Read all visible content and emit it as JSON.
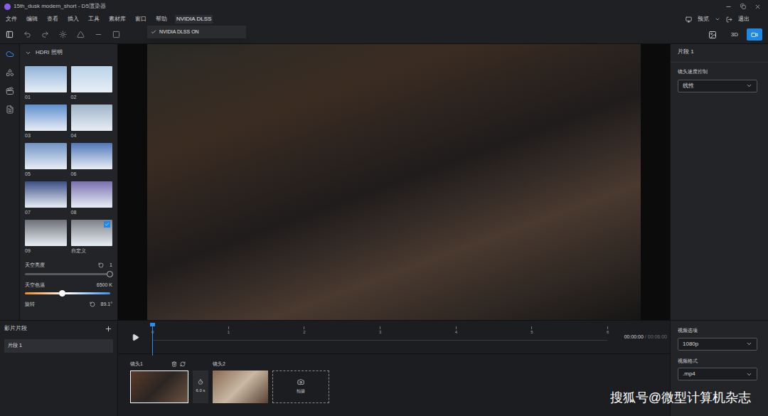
{
  "window": {
    "title": "15th_dusk modern_short - D5渲染器"
  },
  "menu": [
    {
      "label": "文件",
      "open": false
    },
    {
      "label": "编辑",
      "open": false
    },
    {
      "label": "查看",
      "open": false
    },
    {
      "label": "插入",
      "open": false
    },
    {
      "label": "工具",
      "open": false
    },
    {
      "label": "素材库",
      "open": false
    },
    {
      "label": "窗口",
      "open": false
    },
    {
      "label": "帮助",
      "open": false
    },
    {
      "label": "NVIDIA DLSS",
      "open": true
    }
  ],
  "dropdown": {
    "items": [
      {
        "label": "NVIDIA DLSS ON",
        "checked": true
      }
    ]
  },
  "header_right": {
    "preview": "预览",
    "exit": "退出"
  },
  "mode_3d": {
    "label": "3D",
    "selected": false
  },
  "mode_camera": {
    "selected": true
  },
  "left_nav": [
    {
      "selected": true
    },
    {
      "selected": false
    },
    {
      "selected": false
    },
    {
      "selected": false
    }
  ],
  "hdri": {
    "title": "HDRI 照明",
    "expanded": true,
    "presets": [
      {
        "label": "01",
        "selected": false,
        "color": "#8fb3d9"
      },
      {
        "label": "02",
        "selected": false,
        "color": "#b9d3ea"
      },
      {
        "label": "03",
        "selected": false,
        "color": "#5d8fcf"
      },
      {
        "label": "04",
        "selected": false,
        "color": "#9fb5c9"
      },
      {
        "label": "05",
        "selected": false,
        "color": "#6f94c4"
      },
      {
        "label": "06",
        "selected": false,
        "color": "#4f78b8"
      },
      {
        "label": "07",
        "selected": false,
        "color": "#3b4f86"
      },
      {
        "label": "08",
        "selected": false,
        "color": "#7a6fb0"
      },
      {
        "label": "09",
        "selected": false,
        "color": "#6c6f76"
      },
      {
        "label": "自定义",
        "selected": true,
        "color": "#7d8087"
      }
    ]
  },
  "sliders": [
    {
      "label": "天空亮度",
      "reading": "1",
      "level": 1.0,
      "kind": "plain",
      "reset": true
    },
    {
      "label": "天空色温",
      "reading": "6500 K",
      "level": 0.44,
      "kind": "gradient",
      "reset": false
    },
    {
      "label": "旋转",
      "reading": "89.1°",
      "kind": "cut",
      "reset": true
    }
  ],
  "right_panel": {
    "title": "片段 1",
    "speed_label": "镜头速度控制",
    "speed_value": "线性"
  },
  "clips_panel": {
    "title": "影片片段",
    "items": [
      {
        "label": "片段 1",
        "selected": true
      }
    ]
  },
  "timeline": {
    "ticks": [
      "0",
      "1",
      "2",
      "3",
      "4",
      "5",
      "6"
    ],
    "playhead": 0,
    "time": "00:00:00",
    "duration": "/ 00:06:00"
  },
  "shots": [
    {
      "label": "镜头1",
      "selected": true,
      "duration": "6.0 s"
    },
    {
      "label": "镜头2",
      "selected": false
    }
  ],
  "add_shot": "拍摄",
  "video": {
    "options_label": "视频选项",
    "options_value": "1080p",
    "format_label": "视频格式",
    "format_value": ".mp4"
  },
  "watermark": "搜狐号@微型计算机杂志"
}
